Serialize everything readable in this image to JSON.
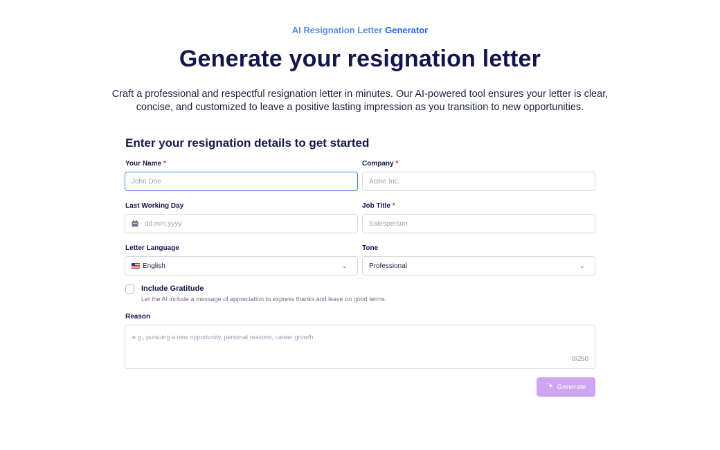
{
  "header": {
    "eyebrow_part1": "AI Resignation Letter",
    "eyebrow_part2": "Generator",
    "title": "Generate your resignation letter",
    "subtitle": "Craft a professional and respectful resignation letter in minutes. Our AI-powered tool ensures your letter is clear, concise, and customized to leave a positive lasting impression as you transition to new opportunities."
  },
  "form": {
    "heading": "Enter your resignation details to get started",
    "required_mark": "*",
    "name": {
      "label": "Your Name",
      "placeholder": "John Doe",
      "required": true
    },
    "company": {
      "label": "Company",
      "placeholder": "Acme Inc.",
      "required": true
    },
    "last_day": {
      "label": "Last Working Day",
      "placeholder": "dd.mm.yyyy",
      "icon": "calendar-icon"
    },
    "job_title": {
      "label": "Job Title",
      "placeholder": "Salesperson",
      "required": true
    },
    "language": {
      "label": "Letter Language",
      "value": "English",
      "icon": "us-flag-icon"
    },
    "tone": {
      "label": "Tone",
      "value": "Professional"
    },
    "gratitude": {
      "label": "Include Gratitude",
      "description": "Let the AI include a message of appreciation to express thanks and leave on good terms.",
      "checked": false
    },
    "reason": {
      "label": "Reason",
      "placeholder": "e.g., pursuing a new opportunity, personal reasons, career growth",
      "counter": "0/250"
    },
    "generate_label": "Generate"
  },
  "colors": {
    "heading": "#12164a",
    "accent_blue": "#2563eb",
    "required": "#e0303a",
    "button_disabled": "#cfa6f4"
  }
}
